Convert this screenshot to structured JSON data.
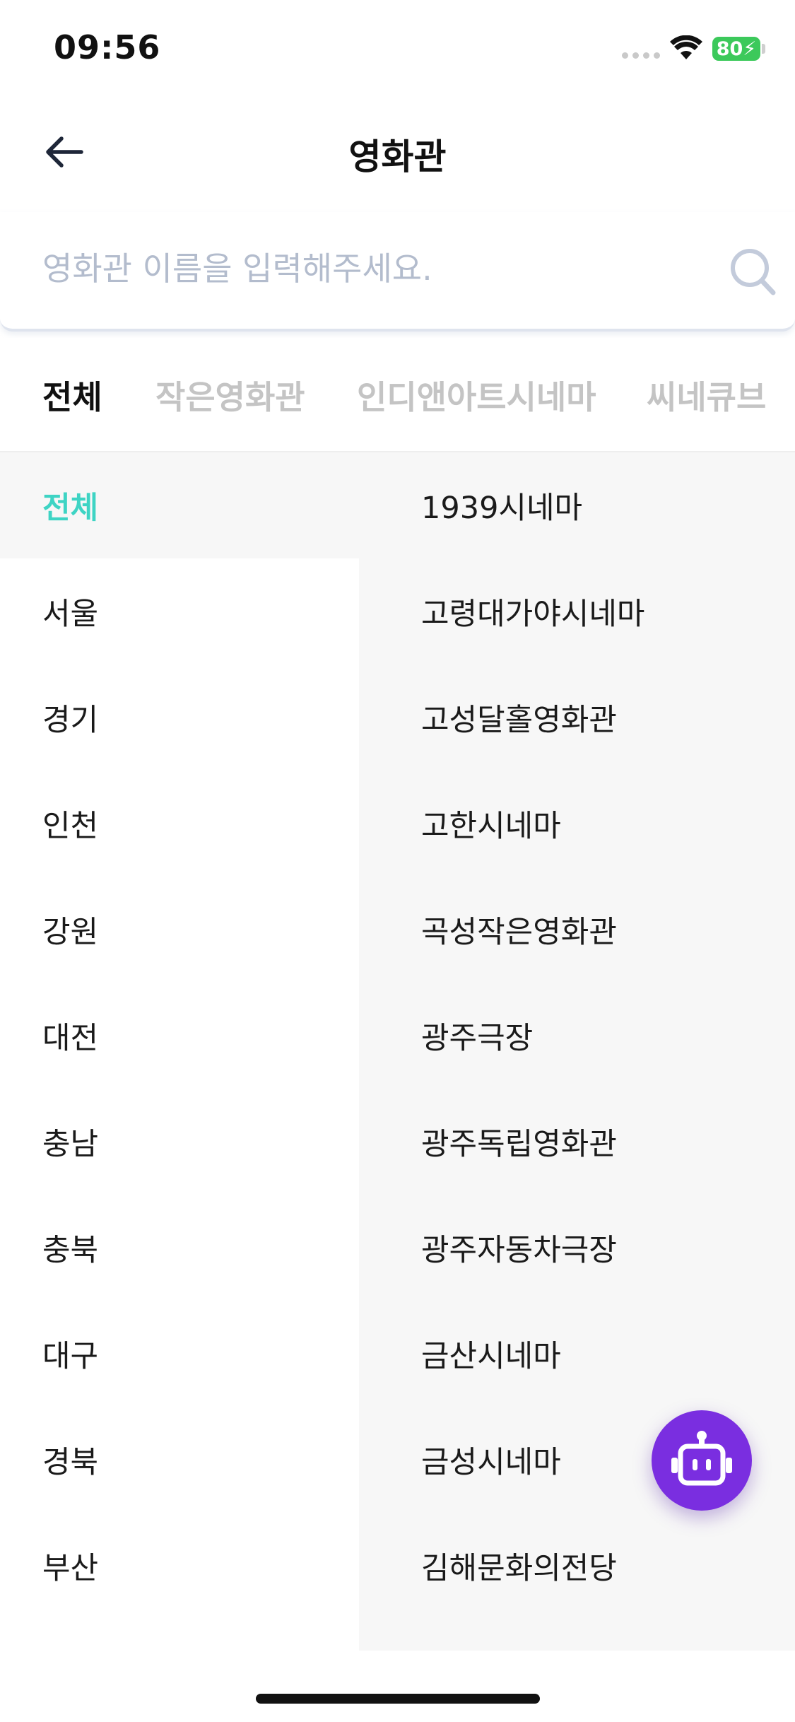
{
  "status_bar": {
    "time": "09:56",
    "battery": "80"
  },
  "header": {
    "title": "영화관"
  },
  "search": {
    "placeholder": "영화관 이름을 입력해주세요."
  },
  "tabs": [
    {
      "label": "전체",
      "active": true
    },
    {
      "label": "작은영화관",
      "active": false
    },
    {
      "label": "인디앤아트시네마",
      "active": false
    },
    {
      "label": "씨네큐브",
      "active": false
    }
  ],
  "regions": [
    {
      "label": "전체",
      "active": true
    },
    {
      "label": "서울"
    },
    {
      "label": "경기"
    },
    {
      "label": "인천"
    },
    {
      "label": "강원"
    },
    {
      "label": "대전"
    },
    {
      "label": "충남"
    },
    {
      "label": "충북"
    },
    {
      "label": "대구"
    },
    {
      "label": "경북"
    },
    {
      "label": "부산"
    }
  ],
  "theaters": [
    "1939시네마",
    "고령대가야시네마",
    "고성달홀영화관",
    "고한시네마",
    "곡성작은영화관",
    "광주극장",
    "광주독립영화관",
    "광주자동차극장",
    "금산시네마",
    "금성시네마",
    "김해문화의전당"
  ],
  "colors": {
    "accent": "#3ed4c4",
    "bot_button": "#7a2ee0",
    "battery": "#3cc95b",
    "placeholder": "#b3bccd"
  },
  "icons": [
    "back-arrow-icon",
    "search-icon",
    "wifi-icon",
    "robot-icon"
  ]
}
